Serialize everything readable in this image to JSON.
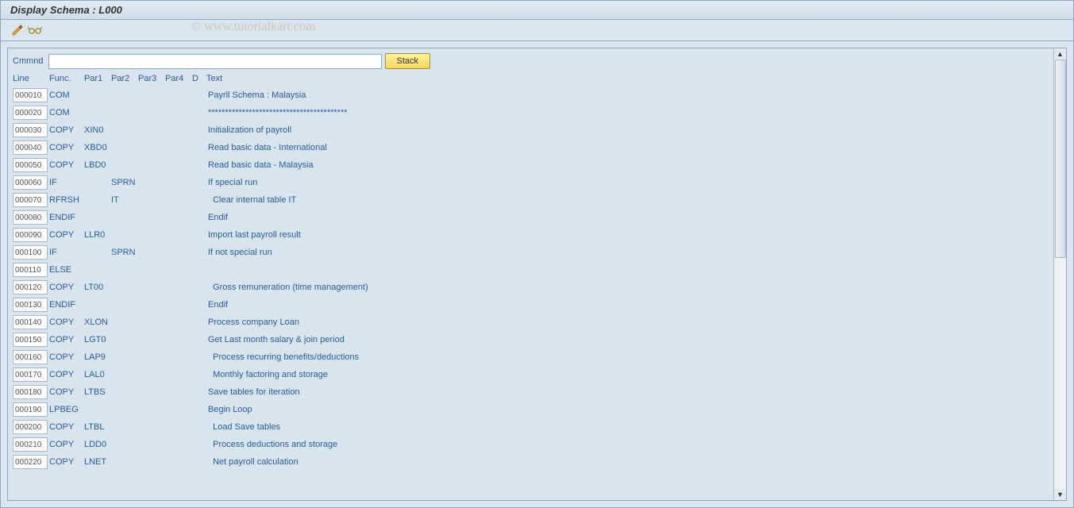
{
  "title": "Display Schema : L000",
  "watermark": "© www.tutorialkart.com",
  "command": {
    "label": "Cmmnd",
    "value": "",
    "stack_label": "Stack"
  },
  "headers": {
    "line": "Line",
    "func": "Func.",
    "par1": "Par1",
    "par2": "Par2",
    "par3": "Par3",
    "par4": "Par4",
    "d": "D",
    "text": "Text"
  },
  "rows": [
    {
      "line": "000010",
      "func": "COM",
      "par1": "",
      "par2": "",
      "par3": "",
      "par4": "",
      "d": "",
      "text": "Payrll Schema : Malaysia"
    },
    {
      "line": "000020",
      "func": "COM",
      "par1": "",
      "par2": "",
      "par3": "",
      "par4": "",
      "d": "",
      "text": "*****************************************"
    },
    {
      "line": "000030",
      "func": "COPY",
      "par1": "XIN0",
      "par2": "",
      "par3": "",
      "par4": "",
      "d": "",
      "text": "Initialization of payroll"
    },
    {
      "line": "000040",
      "func": "COPY",
      "par1": "XBD0",
      "par2": "",
      "par3": "",
      "par4": "",
      "d": "",
      "text": "Read basic data - International"
    },
    {
      "line": "000050",
      "func": "COPY",
      "par1": "LBD0",
      "par2": "",
      "par3": "",
      "par4": "",
      "d": "",
      "text": "Read basic data - Malaysia"
    },
    {
      "line": "000060",
      "func": "IF",
      "par1": "",
      "par2": "SPRN",
      "par3": "",
      "par4": "",
      "d": "",
      "text": "If special run"
    },
    {
      "line": "000070",
      "func": "RFRSH",
      "par1": "",
      "par2": "IT",
      "par3": "",
      "par4": "",
      "d": "",
      "text": "  Clear internal table IT"
    },
    {
      "line": "000080",
      "func": "ENDIF",
      "par1": "",
      "par2": "",
      "par3": "",
      "par4": "",
      "d": "",
      "text": "Endif"
    },
    {
      "line": "000090",
      "func": "COPY",
      "par1": "LLR0",
      "par2": "",
      "par3": "",
      "par4": "",
      "d": "",
      "text": "Import last payroll result"
    },
    {
      "line": "000100",
      "func": "IF",
      "par1": "",
      "par2": "SPRN",
      "par3": "",
      "par4": "",
      "d": "",
      "text": "If not special run"
    },
    {
      "line": "000110",
      "func": "ELSE",
      "par1": "",
      "par2": "",
      "par3": "",
      "par4": "",
      "d": "",
      "text": ""
    },
    {
      "line": "000120",
      "func": "COPY",
      "par1": "LT00",
      "par2": "",
      "par3": "",
      "par4": "",
      "d": "",
      "text": "  Gross remuneration (time management)"
    },
    {
      "line": "000130",
      "func": "ENDIF",
      "par1": "",
      "par2": "",
      "par3": "",
      "par4": "",
      "d": "",
      "text": "Endif"
    },
    {
      "line": "000140",
      "func": "COPY",
      "par1": "XLON",
      "par2": "",
      "par3": "",
      "par4": "",
      "d": "",
      "text": "Process company Loan"
    },
    {
      "line": "000150",
      "func": "COPY",
      "par1": "LGT0",
      "par2": "",
      "par3": "",
      "par4": "",
      "d": "",
      "text": "Get Last month salary & join period"
    },
    {
      "line": "000160",
      "func": "COPY",
      "par1": "LAP9",
      "par2": "",
      "par3": "",
      "par4": "",
      "d": "",
      "text": "  Process recurring benefits/deductions"
    },
    {
      "line": "000170",
      "func": "COPY",
      "par1": "LAL0",
      "par2": "",
      "par3": "",
      "par4": "",
      "d": "",
      "text": "  Monthly factoring and storage"
    },
    {
      "line": "000180",
      "func": "COPY",
      "par1": "LTBS",
      "par2": "",
      "par3": "",
      "par4": "",
      "d": "",
      "text": "Save tables for iteration"
    },
    {
      "line": "000190",
      "func": "LPBEG",
      "par1": "",
      "par2": "",
      "par3": "",
      "par4": "",
      "d": "",
      "text": "Begin Loop"
    },
    {
      "line": "000200",
      "func": "COPY",
      "par1": "LTBL",
      "par2": "",
      "par3": "",
      "par4": "",
      "d": "",
      "text": "  Load Save tables"
    },
    {
      "line": "000210",
      "func": "COPY",
      "par1": "LDD0",
      "par2": "",
      "par3": "",
      "par4": "",
      "d": "",
      "text": "  Process deductions and storage"
    },
    {
      "line": "000220",
      "func": "COPY",
      "par1": "LNET",
      "par2": "",
      "par3": "",
      "par4": "",
      "d": "",
      "text": "  Net payroll calculation"
    }
  ]
}
